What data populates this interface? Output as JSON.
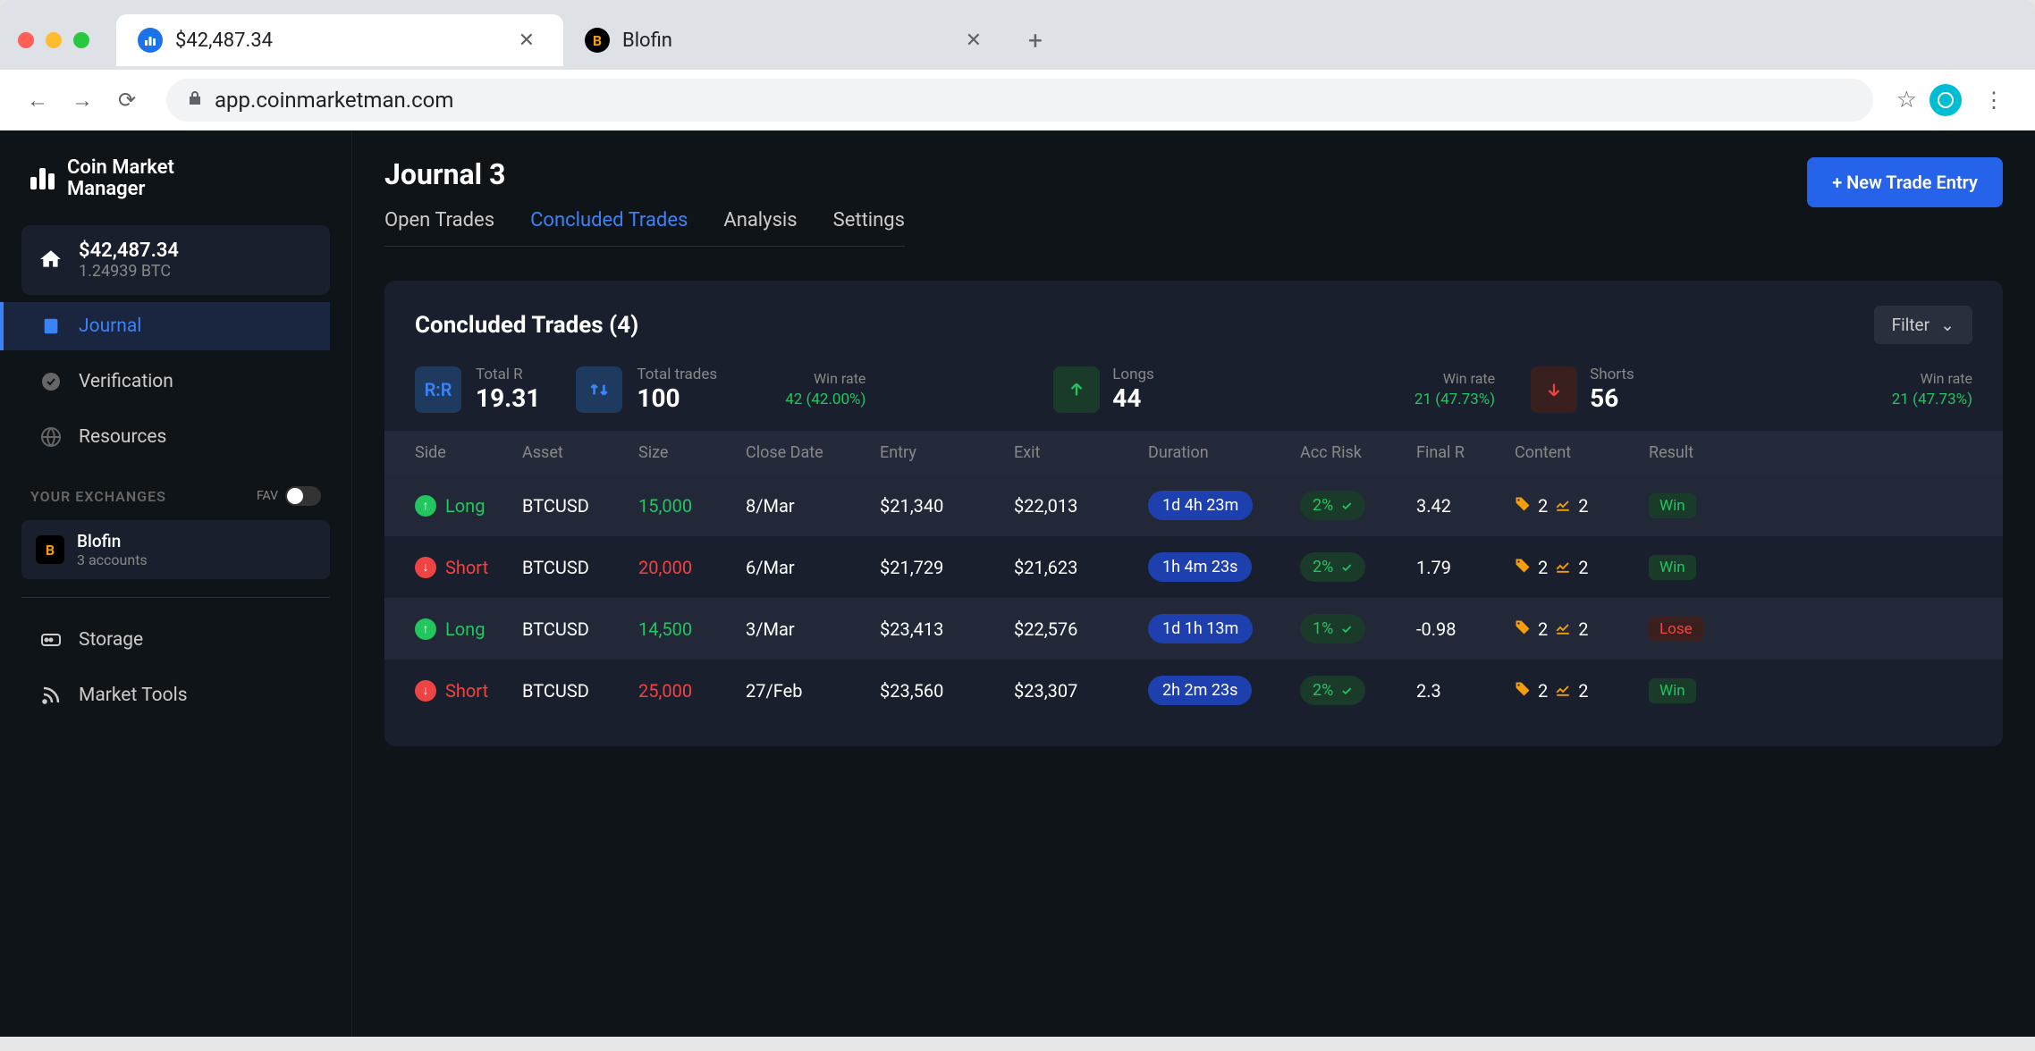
{
  "browser": {
    "tabs": [
      {
        "title": "$42,487.34",
        "favicon_bg": "#1a73e8"
      },
      {
        "title": "Blofin",
        "favicon_bg": "#000"
      }
    ],
    "address": "app.coinmarketman.com"
  },
  "app": {
    "logo": "Coin Market Manager",
    "balance": {
      "usd": "$42,487.34",
      "btc": "1.24939 BTC"
    },
    "nav": [
      {
        "label": "Journal",
        "icon": "journal",
        "active": true
      },
      {
        "label": "Verification",
        "icon": "check"
      },
      {
        "label": "Resources",
        "icon": "globe"
      }
    ],
    "exchanges_label": "YOUR EXCHANGES",
    "fav_label": "FAV",
    "exchanges": [
      {
        "name": "Blofin",
        "sub": "3 accounts",
        "badge": "B",
        "badge_bg": "#f59e0b"
      }
    ],
    "footer_nav": [
      {
        "label": "Storage",
        "icon": "storage"
      },
      {
        "label": "Market Tools",
        "icon": "rss"
      }
    ]
  },
  "page": {
    "title": "Journal 3",
    "new_entry_btn": "+ New Trade Entry",
    "tabs": [
      {
        "label": "Open Trades"
      },
      {
        "label": "Concluded Trades",
        "active": true
      },
      {
        "label": "Analysis"
      },
      {
        "label": "Settings"
      }
    ],
    "panel_title": "Concluded Trades (4)",
    "filter_label": "Filter",
    "stats": {
      "rr": {
        "label": "Total R",
        "value": "19.31",
        "badge": "R:R"
      },
      "trades": {
        "label": "Total trades",
        "value": "100",
        "winrate_label": "Win rate",
        "winrate": "42 (42.00%)"
      },
      "longs": {
        "label": "Longs",
        "value": "44",
        "winrate_label": "Win rate",
        "winrate": "21 (47.73%)"
      },
      "shorts": {
        "label": "Shorts",
        "value": "56",
        "winrate_label": "Win rate",
        "winrate": "21 (47.73%)"
      }
    },
    "columns": [
      "Side",
      "Asset",
      "Size",
      "Close Date",
      "Entry",
      "Exit",
      "Duration",
      "Acc Risk",
      "Final R",
      "Content",
      "Result"
    ],
    "rows": [
      {
        "side": "Long",
        "asset": "BTCUSD",
        "size": "15,000",
        "size_color": "green",
        "close": "8/Mar",
        "entry": "$21,340",
        "exit": "$22,013",
        "duration": "1d 4h 23m",
        "risk": "2%",
        "final_r": "3.42",
        "tags": "2",
        "charts": "2",
        "result": "Win"
      },
      {
        "side": "Short",
        "asset": "BTCUSD",
        "size": "20,000",
        "size_color": "red",
        "close": "6/Mar",
        "entry": "$21,729",
        "exit": "$21,623",
        "duration": "1h 4m 23s",
        "risk": "2%",
        "final_r": "1.79",
        "tags": "2",
        "charts": "2",
        "result": "Win"
      },
      {
        "side": "Long",
        "asset": "BTCUSD",
        "size": "14,500",
        "size_color": "green",
        "close": "3/Mar",
        "entry": "$23,413",
        "exit": "$22,576",
        "duration": "1d 1h 13m",
        "risk": "1%",
        "final_r": "-0.98",
        "tags": "2",
        "charts": "2",
        "result": "Lose"
      },
      {
        "side": "Short",
        "asset": "BTCUSD",
        "size": "25,000",
        "size_color": "red",
        "close": "27/Feb",
        "entry": "$23,560",
        "exit": "$23,307",
        "duration": "2h 2m 23s",
        "risk": "2%",
        "final_r": "2.3",
        "tags": "2",
        "charts": "2",
        "result": "Win"
      }
    ]
  }
}
